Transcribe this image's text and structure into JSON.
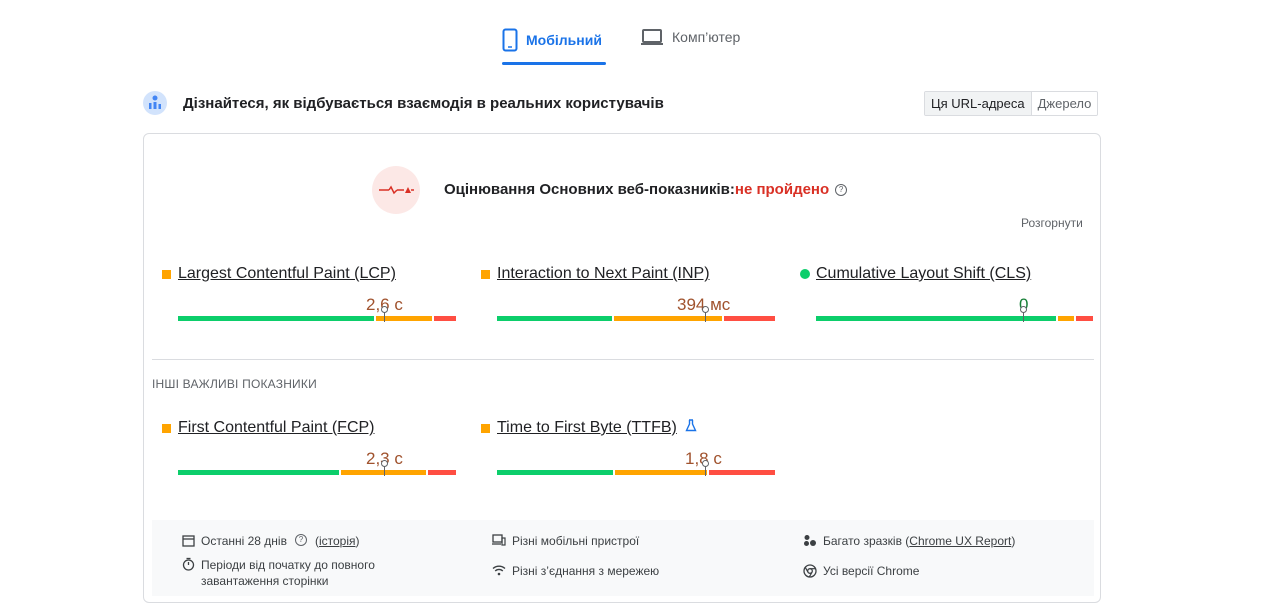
{
  "tabs": {
    "mobile_label": "Мобільний",
    "desktop_label": "Комп’ютер"
  },
  "field": {
    "title": "Дізнайтеся, як відбувається взаємодія в реальних користувачів",
    "toggle": [
      "Ця URL-адреса",
      "Джерело"
    ]
  },
  "assessment": {
    "label": "Оцінювання Основних веб-показників:",
    "status": "не пройдено",
    "expand": "Розгорнути"
  },
  "core_metrics": [
    {
      "name": "Largest Contentful Paint (LCP)",
      "value": "2,6 с",
      "status": "average"
    },
    {
      "name": "Interaction to Next Paint (INP)",
      "value": "394 мс",
      "status": "average"
    },
    {
      "name": "Cumulative Layout Shift (CLS)",
      "value": "0",
      "status": "good"
    }
  ],
  "other_section_label": "ІНШІ ВАЖЛИВІ ПОКАЗНИКИ",
  "other_metrics": [
    {
      "name": "First Contentful Paint (FCP)",
      "value": "2,3 с",
      "status": "average"
    },
    {
      "name": "Time to First Byte (TTFB)",
      "value": "1,8 с",
      "status": "average"
    }
  ],
  "footer": {
    "period": "Останні 28 днів",
    "history_link": "історія",
    "load_periods": "Періоди від початку до повного завантаження сторінки",
    "devices": "Різні мобільні пристрої",
    "connections": "Різні з’єднання з мережею",
    "samples_prefix": "Багато зразків (",
    "samples_link": "Chrome UX Report",
    "samples_suffix": ")",
    "chrome_versions": "Усі версії Chrome"
  },
  "colors": {
    "good": "#0cce6b",
    "average": "#ffa400",
    "poor": "#ff4e42",
    "accent": "#1a73e8",
    "fail": "#d93025"
  }
}
